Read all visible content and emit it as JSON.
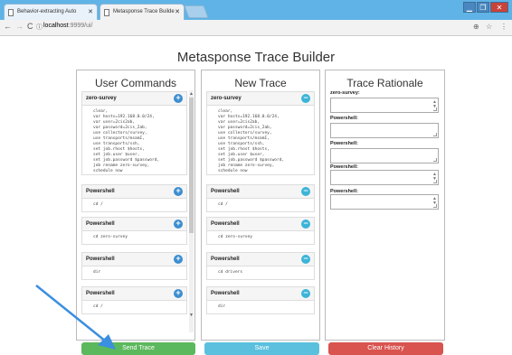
{
  "browser": {
    "tabs": [
      {
        "label": "Behavior-extracting Auto"
      },
      {
        "label": "Metasponse Trace Builde"
      }
    ],
    "url_host": "localhost",
    "url_path": ":9999/ui/"
  },
  "page": {
    "title": "Metasponse Trace Builder"
  },
  "user_commands": {
    "heading": "User Commands",
    "panels": [
      {
        "title": "zero-survey",
        "code": "clear,\nvar hosts=192.168.0.0/24,\nvar user=2cis2ab,\nvar password=2cis_2ab,\nuse collectors/survey,\nuse transports/msamI,\nuse transports/ssh,\nset job.rhost $hosts,\nset job.user $user,\nset job.password $password,\njob rename zero-survey,\nschedule now"
      },
      {
        "title": "Powershell",
        "code": "cd /"
      },
      {
        "title": "Powershell",
        "code": "cd zero-survey"
      },
      {
        "title": "Powershell",
        "code": "dir"
      },
      {
        "title": "Powershell",
        "code": "cd /"
      }
    ]
  },
  "new_trace": {
    "heading": "New Trace",
    "panels": [
      {
        "title": "zero-survey",
        "code": "clear,\nvar hosts=192.168.0.0/24,\nvar user=2cis2ab,\nvar password=2cis_2ab,\nuse collectors/survey,\nuse transports/msamI,\nuse transports/ssh,\nset job.rhost $hosts,\nset job.user $user,\nset job.password $password,\njob rename zero-survey,\nschedule now"
      },
      {
        "title": "Powershell",
        "code": "cd /"
      },
      {
        "title": "Powershell",
        "code": "cd zero-survey"
      },
      {
        "title": "Powershell",
        "code": "cd drivers"
      },
      {
        "title": "Powershell",
        "code": "dir"
      }
    ]
  },
  "rationale": {
    "heading": "Trace Rationale",
    "labels": [
      "zero-survey:",
      "Powershell:",
      "Powershell:",
      "Powershell:",
      "Powershell:"
    ]
  },
  "buttons": {
    "send": "Send Trace",
    "save": "Save",
    "clear": "Clear History"
  },
  "colors": {
    "send": "#5cb85c",
    "save": "#5bc0de",
    "clear": "#d9534f",
    "arrow": "#3b8fe0"
  }
}
